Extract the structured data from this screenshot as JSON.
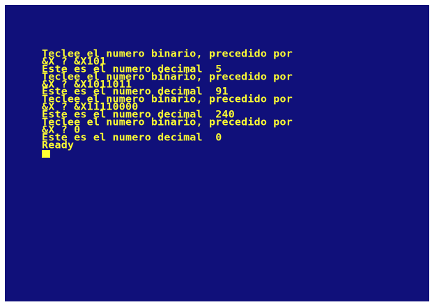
{
  "console": {
    "lines": [
      "Teclee el numero binario, precedido por",
      "&X ? &X101",
      "Este es el numero decimal  5",
      "Teclee el numero binario, precedido por",
      "&X ? &X1011011",
      "Este es el numero decimal  91",
      "Teclee el numero binario, precedido por",
      "&X ? &X11110000",
      "Este es el numero decimal  240",
      "Teclee el numero binario, precedido por",
      "&X ? 0",
      "Este es el numero decimal  0",
      "Ready"
    ]
  },
  "colors": {
    "background": "#10107a",
    "text": "#ffff33",
    "border": "#ffffff"
  }
}
